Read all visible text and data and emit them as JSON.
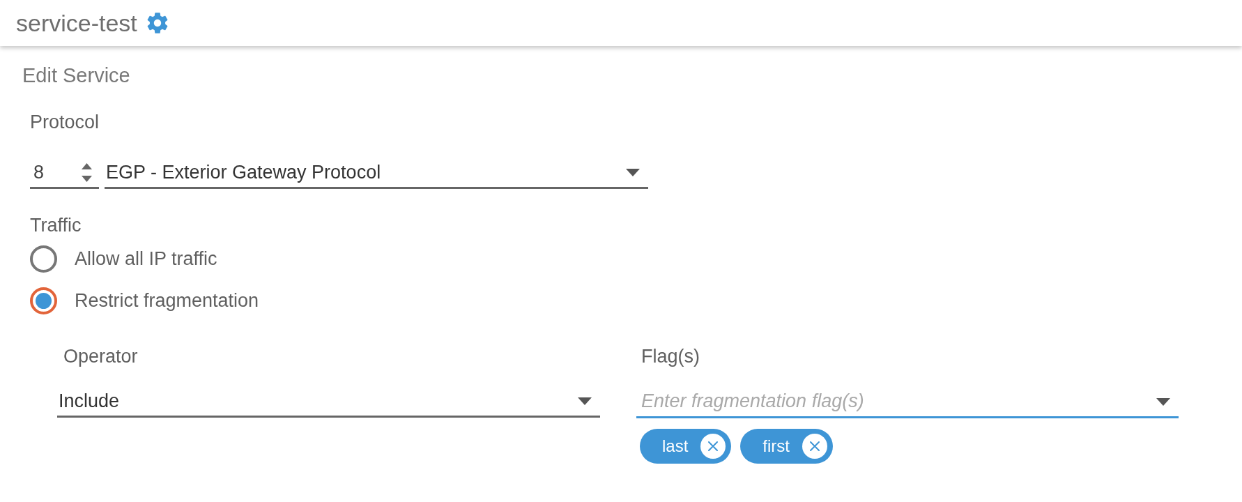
{
  "header": {
    "title": "service-test"
  },
  "page_title": "Edit Service",
  "protocol": {
    "label": "Protocol",
    "number": "8",
    "value": "EGP - Exterior Gateway Protocol"
  },
  "traffic": {
    "label": "Traffic",
    "options": [
      {
        "label": "Allow all IP traffic",
        "selected": false
      },
      {
        "label": "Restrict fragmentation",
        "selected": true
      }
    ]
  },
  "operator": {
    "label": "Operator",
    "value": "Include"
  },
  "flags": {
    "label": "Flag(s)",
    "placeholder": "Enter fragmentation flag(s)",
    "focused": true,
    "chips": [
      "last",
      "first"
    ]
  }
}
